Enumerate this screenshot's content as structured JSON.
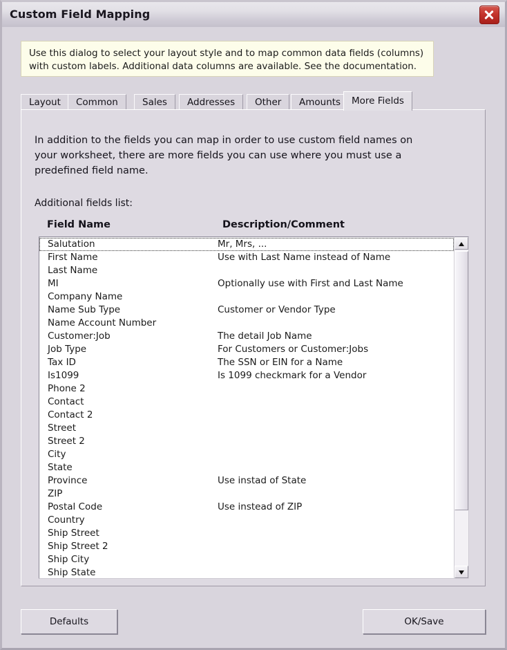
{
  "window": {
    "title": "Custom Field Mapping",
    "close_icon": "close-icon"
  },
  "info": {
    "lines": [
      "Use this dialog to select your layout style and to map common data fields (columns)",
      "with custom labels. Additional data columns are available. See the documentation."
    ]
  },
  "tabs": [
    {
      "label": "Layout",
      "active": false
    },
    {
      "label": "Common",
      "active": false
    },
    {
      "label": "Sales",
      "active": false
    },
    {
      "label": "Addresses",
      "active": false
    },
    {
      "label": "Other",
      "active": false
    },
    {
      "label": "Amounts",
      "active": false
    },
    {
      "label": "More Fields",
      "active": true
    }
  ],
  "panel": {
    "paragraph": [
      "In addition to the fields you can map in order to use custom field names on",
      "your worksheet, there are more fields you can use where you must use a",
      "predefined field name."
    ],
    "subhead": "Additional fields list:",
    "columns": {
      "name": "Field Name",
      "description": "Description/Comment"
    },
    "rows": [
      {
        "name": "Salutation",
        "description": "Mr, Mrs, ...",
        "focused": true
      },
      {
        "name": "First Name",
        "description": "Use with Last Name instead of Name",
        "focused": false
      },
      {
        "name": "Last Name",
        "description": "",
        "focused": false
      },
      {
        "name": "MI",
        "description": "Optionally use with First and Last Name",
        "focused": false
      },
      {
        "name": "Company Name",
        "description": "",
        "focused": false
      },
      {
        "name": "Name Sub Type",
        "description": "Customer or Vendor Type",
        "focused": false
      },
      {
        "name": "Name Account Number",
        "description": "",
        "focused": false
      },
      {
        "name": "Customer:Job",
        "description": "The detail Job Name",
        "focused": false
      },
      {
        "name": "Job Type",
        "description": "For Customers or Customer:Jobs",
        "focused": false
      },
      {
        "name": "Tax ID",
        "description": "The SSN or EIN for a Name",
        "focused": false
      },
      {
        "name": "Is1099",
        "description": "Is 1099 checkmark for a Vendor",
        "focused": false
      },
      {
        "name": "Phone 2",
        "description": "",
        "focused": false
      },
      {
        "name": "Contact",
        "description": "",
        "focused": false
      },
      {
        "name": "Contact 2",
        "description": "",
        "focused": false
      },
      {
        "name": "Street",
        "description": "",
        "focused": false
      },
      {
        "name": "Street 2",
        "description": "",
        "focused": false
      },
      {
        "name": "City",
        "description": "",
        "focused": false
      },
      {
        "name": "State",
        "description": "",
        "focused": false
      },
      {
        "name": "Province",
        "description": "Use instad of State",
        "focused": false
      },
      {
        "name": "ZIP",
        "description": "",
        "focused": false
      },
      {
        "name": "Postal Code",
        "description": "Use instead of ZIP",
        "focused": false
      },
      {
        "name": "Country",
        "description": "",
        "focused": false
      },
      {
        "name": "Ship Street",
        "description": "",
        "focused": false
      },
      {
        "name": "Ship Street 2",
        "description": "",
        "focused": false
      },
      {
        "name": "Ship City",
        "description": "",
        "focused": false
      },
      {
        "name": "Ship State",
        "description": "",
        "focused": false
      }
    ]
  },
  "scrollbar": {
    "up_icon": "scroll-up-arrow-icon",
    "down_icon": "scroll-down-arrow-icon"
  },
  "footer": {
    "defaults_label": "Defaults",
    "oksave_label": "OK/Save"
  },
  "colors": {
    "info_background": "#fdfdea",
    "dialog_background": "#d9d5dd",
    "close_button": "#c5342c",
    "list_background": "#ffffff"
  }
}
